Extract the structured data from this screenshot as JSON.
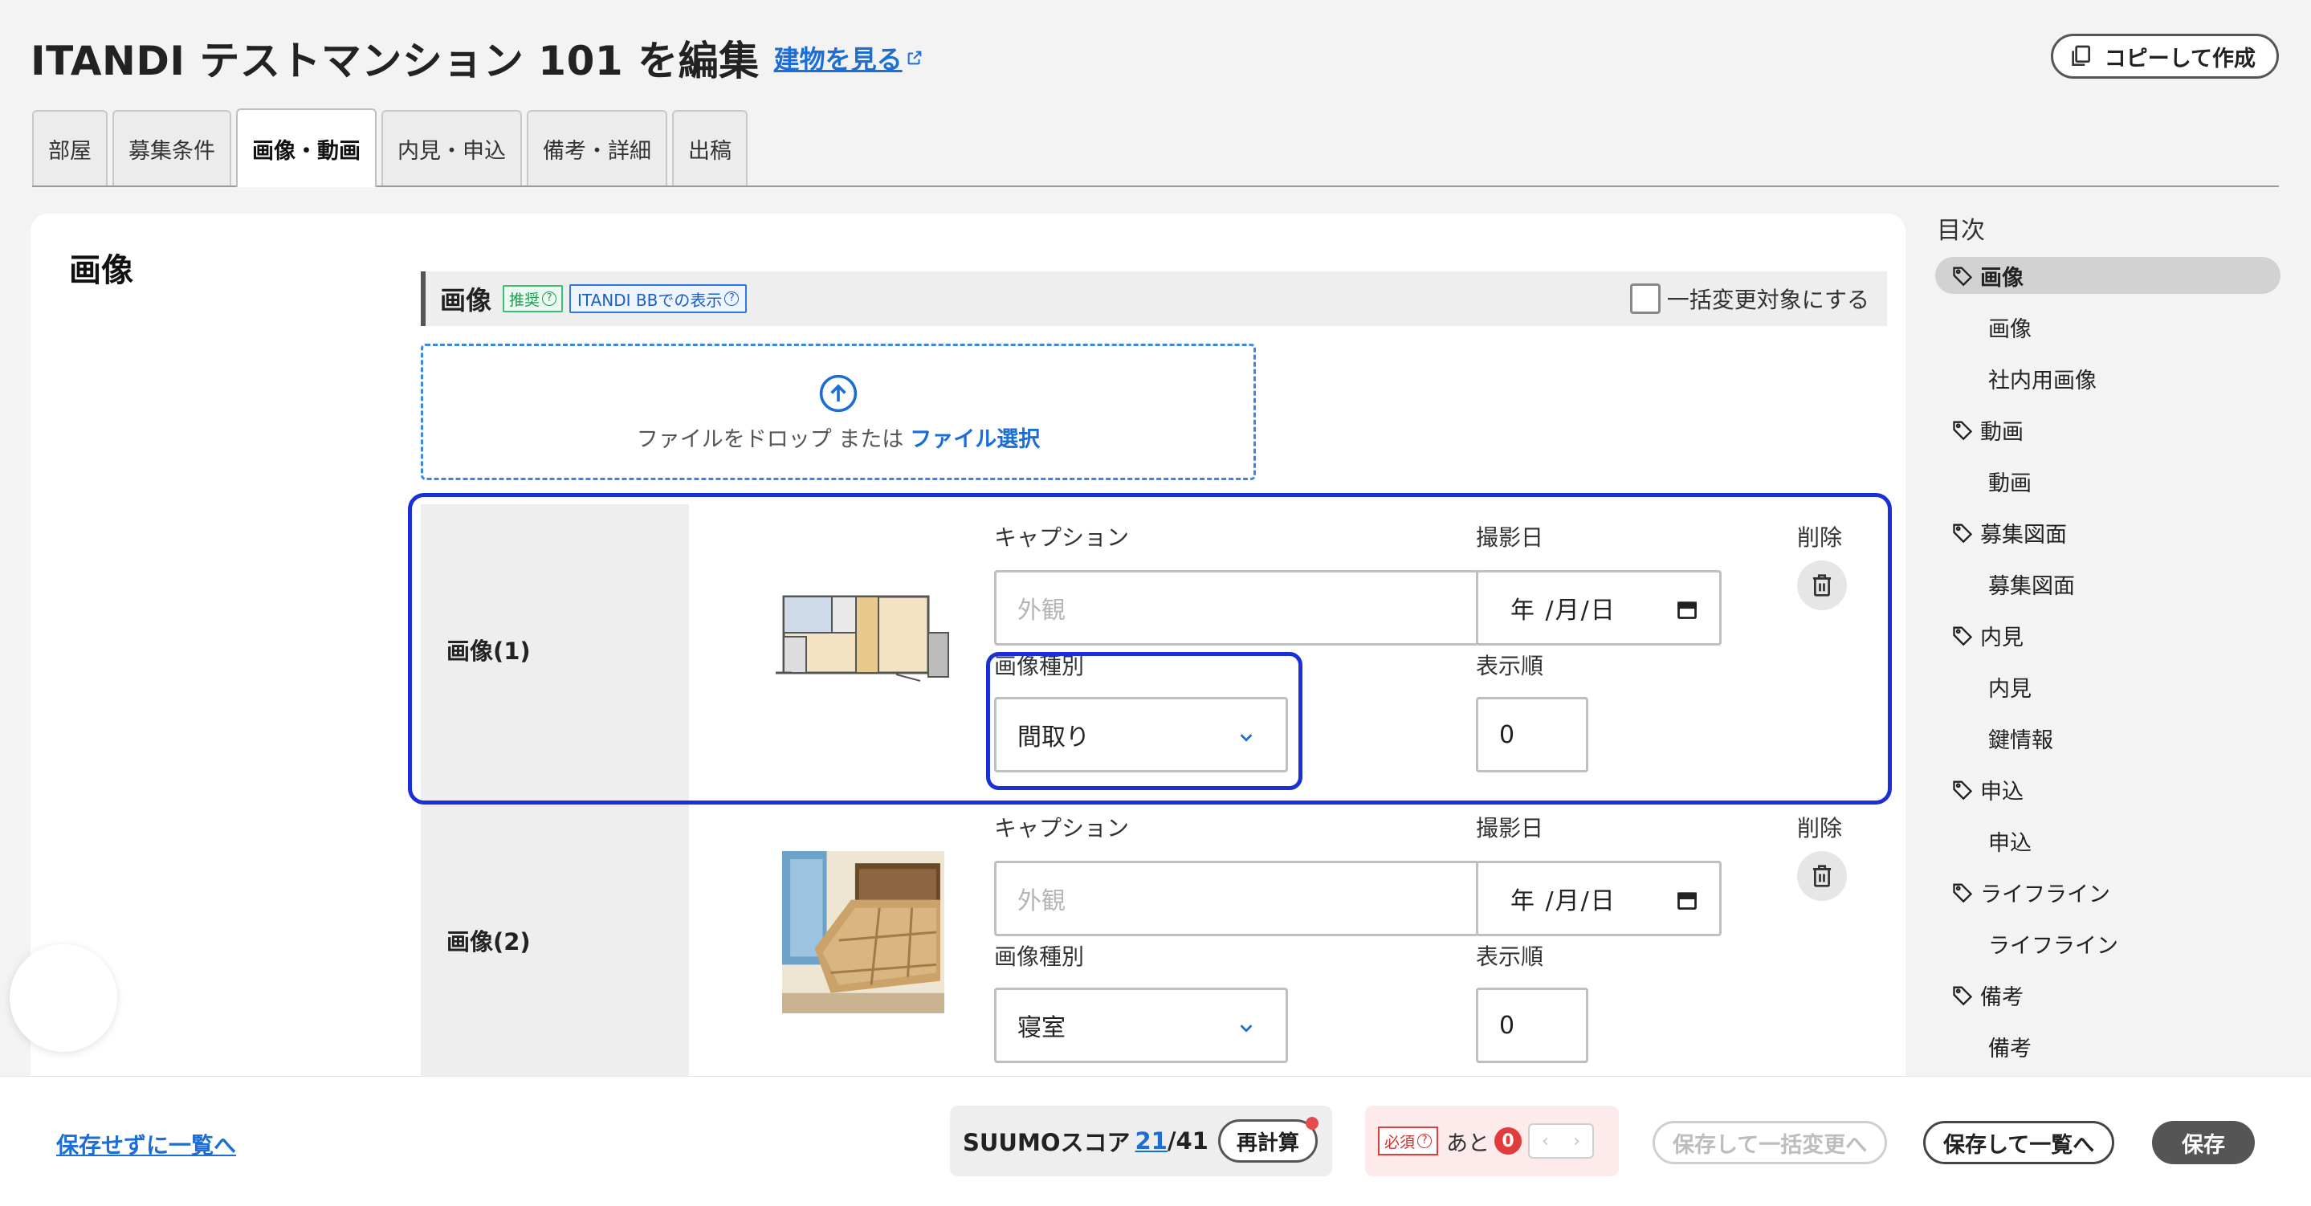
{
  "header": {
    "title": "ITANDI テストマンション 101 を編集",
    "building_link": "建物を見る",
    "copy_button": "コピーして作成"
  },
  "tabs": [
    {
      "label": "部屋",
      "active": false
    },
    {
      "label": "募集条件",
      "active": false
    },
    {
      "label": "画像・動画",
      "active": true
    },
    {
      "label": "内見・申込",
      "active": false
    },
    {
      "label": "備考・詳細",
      "active": false
    },
    {
      "label": "出稿",
      "active": false
    }
  ],
  "section": {
    "title": "画像",
    "subheader": {
      "label": "画像",
      "badge_recommended": "推奨",
      "badge_display": "ITANDI BBでの表示",
      "bulk_checkbox_label": "一括変更対象にする"
    },
    "dropzone": {
      "text": "ファイルをドロップ または",
      "link": "ファイル選択"
    },
    "images": [
      {
        "label": "画像(1)",
        "caption_label": "キャプション",
        "caption_placeholder": "外観",
        "date_label": "撮影日",
        "date_value": "年 /月/日",
        "delete_label": "削除",
        "type_label": "画像種別",
        "type_value": "間取り",
        "order_label": "表示順",
        "order_value": "0"
      },
      {
        "label": "画像(2)",
        "caption_label": "キャプション",
        "caption_placeholder": "外観",
        "date_label": "撮影日",
        "date_value": "年 /月/日",
        "delete_label": "削除",
        "type_label": "画像種別",
        "type_value": "寝室",
        "order_label": "表示順",
        "order_value": "0"
      }
    ]
  },
  "toc": {
    "title": "目次",
    "items": [
      {
        "label": "画像",
        "type": "category",
        "active": true
      },
      {
        "label": "画像",
        "type": "sub"
      },
      {
        "label": "社内用画像",
        "type": "sub"
      },
      {
        "label": "動画",
        "type": "category"
      },
      {
        "label": "動画",
        "type": "sub"
      },
      {
        "label": "募集図面",
        "type": "category"
      },
      {
        "label": "募集図面",
        "type": "sub"
      },
      {
        "label": "内見",
        "type": "category"
      },
      {
        "label": "内見",
        "type": "sub"
      },
      {
        "label": "鍵情報",
        "type": "sub"
      },
      {
        "label": "申込",
        "type": "category"
      },
      {
        "label": "申込",
        "type": "sub"
      },
      {
        "label": "ライフライン",
        "type": "category"
      },
      {
        "label": "ライフライン",
        "type": "sub"
      },
      {
        "label": "備考",
        "type": "category"
      },
      {
        "label": "備考",
        "type": "sub"
      }
    ]
  },
  "footer": {
    "back_link": "保存せずに一覧へ",
    "score_label": "SUUMOスコア",
    "score_value": "21",
    "score_total": "/41",
    "recalc_button": "再計算",
    "required_badge": "必須",
    "required_text": "あと",
    "required_count": "0",
    "save_bulk_button": "保存して一括変更へ",
    "save_list_button": "保存して一覧へ",
    "save_button": "保存"
  },
  "colors": {
    "accent_blue": "#1c6ed6",
    "highlight": "#1a2fd6",
    "danger": "#e23b3b"
  }
}
